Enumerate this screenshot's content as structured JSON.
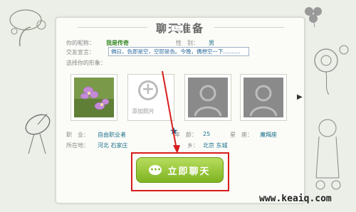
{
  "window": {
    "title": "聊天准备",
    "tab_chip": "ε二"
  },
  "profile": {
    "nickname_label": "你的昵称：",
    "nickname_value": "我是传奇",
    "gender_label": "性　别：",
    "gender_value": "男",
    "declaration_label": "交友宣言：",
    "declaration_value": "佛曰，色即是空，空即是色。今晚，偶想空一下..........",
    "photos_label": "选择你的形象："
  },
  "photos": {
    "add_label": "添加照片"
  },
  "details": {
    "job_label": "职　业：",
    "job_value": "自由职业者",
    "age_label": "年　龄：",
    "age_value": "25",
    "star_label": "星　座：",
    "star_value": "魔羯座",
    "location_label": "所在地：",
    "location_value": "河北 石家庄",
    "hometown_label": "乡：",
    "hometown_value": "北京 东城"
  },
  "actions": {
    "chat_label": "立即聊天",
    "bubble_text": "•••"
  },
  "watermark": "www.keaiq.com",
  "colors": {
    "accent_green": "#7fb321",
    "highlight_red": "#d81c1c",
    "nickname_green": "#3a8a2a",
    "value_teal": "#1b6f8c"
  }
}
